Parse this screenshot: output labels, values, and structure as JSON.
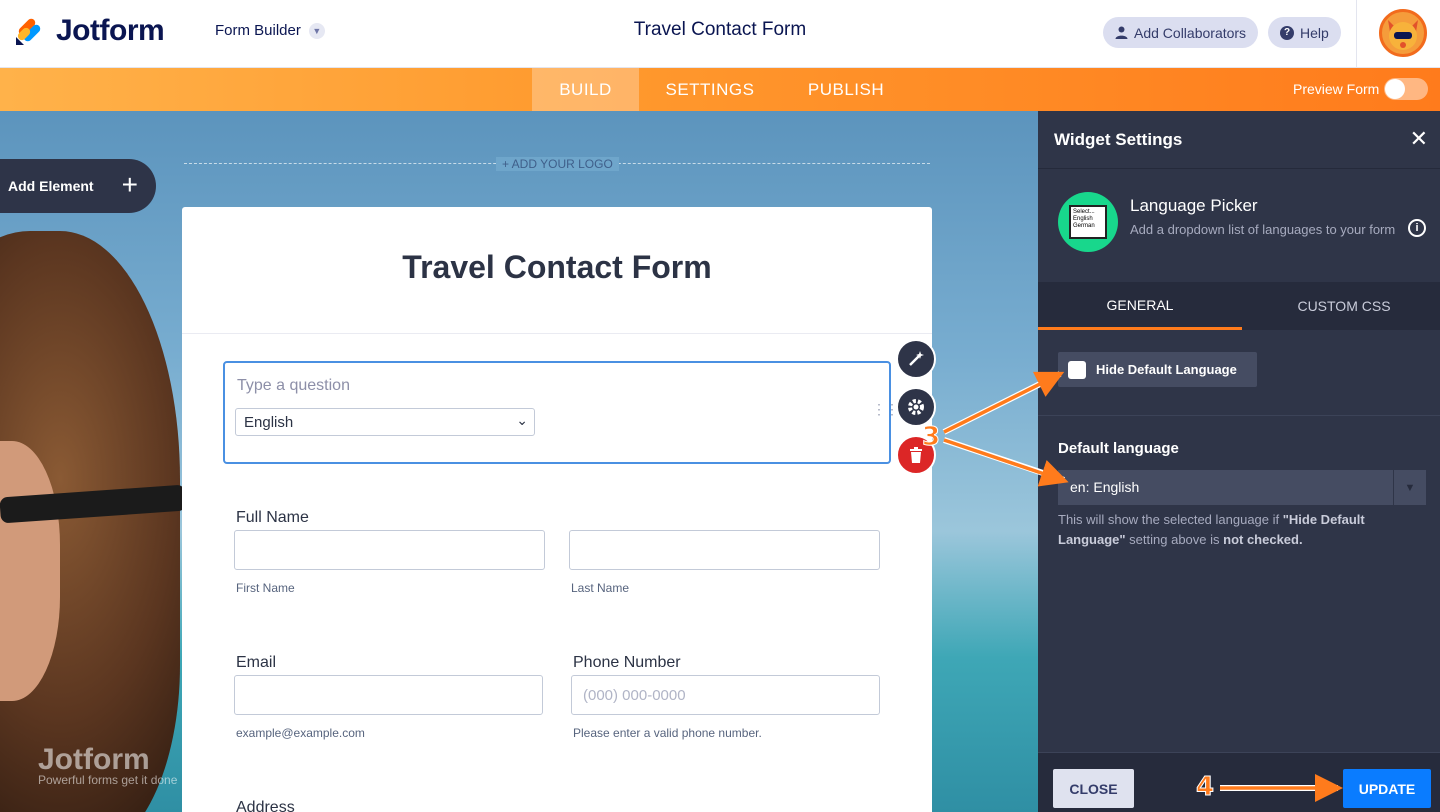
{
  "header": {
    "brand": "Jotform",
    "builder_label": "Form Builder",
    "title": "Travel Contact Form",
    "collaborators_label": "Add Collaborators",
    "help_label": "Help"
  },
  "nav": {
    "tabs": [
      {
        "label": "BUILD",
        "active": true
      },
      {
        "label": "SETTINGS",
        "active": false
      },
      {
        "label": "PUBLISH",
        "active": false
      }
    ],
    "preview_label": "Preview Form",
    "preview_on": false
  },
  "canvas": {
    "add_element_label": "Add Element",
    "add_logo_label": "+ ADD YOUR LOGO",
    "watermark_brand": "Jotform",
    "watermark_tagline": "Powerful forms get it done"
  },
  "form": {
    "title": "Travel Contact Form",
    "question_placeholder": "Type a question",
    "language_value": "English",
    "full_name_label": "Full Name",
    "first_name_sublabel": "First Name",
    "last_name_sublabel": "Last Name",
    "email_label": "Email",
    "email_sublabel": "example@example.com",
    "phone_label": "Phone Number",
    "phone_placeholder": "(000) 000-0000",
    "phone_sublabel": "Please enter a valid phone number.",
    "address_label": "Address"
  },
  "panel": {
    "title": "Widget Settings",
    "widget_name": "Language Picker",
    "widget_description": "Add a dropdown list of languages to your form",
    "widget_thumb_lines": [
      "Select...",
      "English",
      "German"
    ],
    "tabs": [
      {
        "label": "GENERAL",
        "active": true
      },
      {
        "label": "CUSTOM CSS",
        "active": false
      }
    ],
    "hide_default_label": "Hide Default Language",
    "hide_default_checked": false,
    "default_language_label": "Default language",
    "default_language_value": "en: English",
    "note_part1": "This will show the selected language if ",
    "note_bold1": "\"Hide Default Language\"",
    "note_part2": " setting above is ",
    "note_bold2": "not checked.",
    "close_label": "CLOSE",
    "update_label": "UPDATE"
  },
  "annotations": {
    "step3": "3",
    "step4": "4"
  },
  "colors": {
    "accent_orange": "#ff7b1c",
    "panel_bg": "#2f3548",
    "update_blue": "#0a7cff",
    "focus_blue": "#4a90e2"
  }
}
